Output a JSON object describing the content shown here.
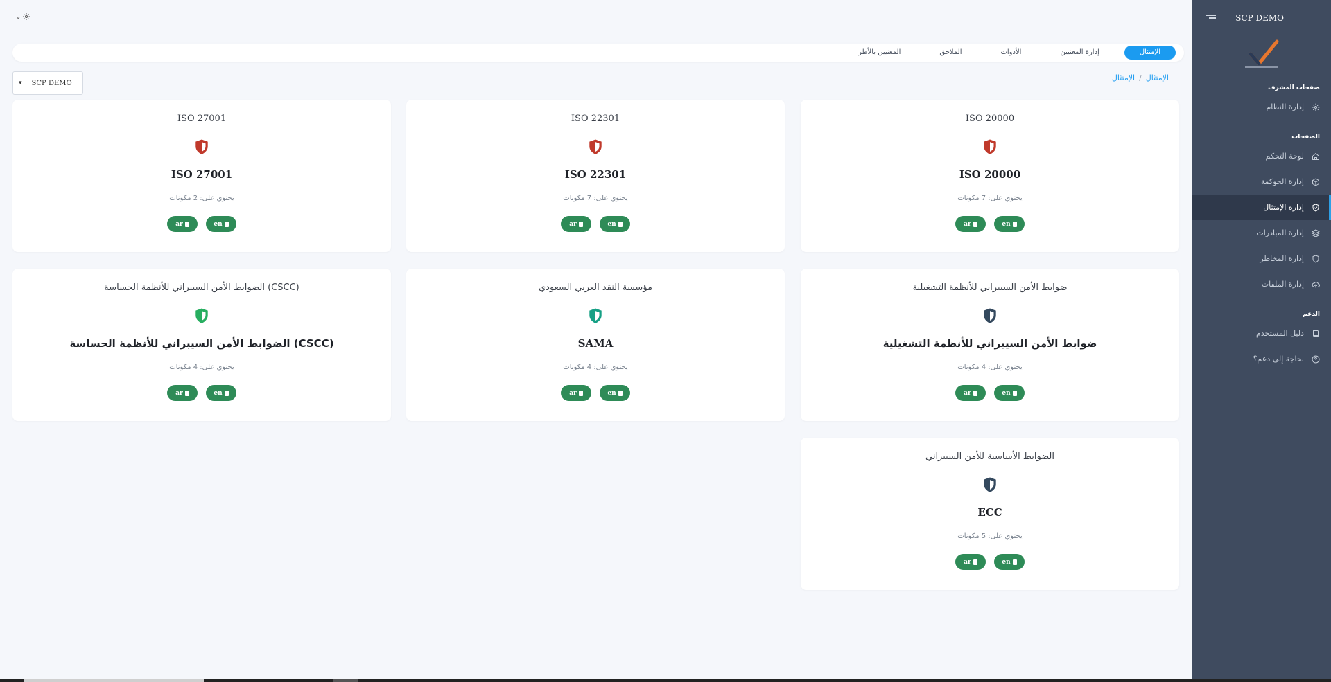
{
  "app": {
    "org_name": "SCP DEMO"
  },
  "sidebar": {
    "title": "SCP DEMO",
    "sections": [
      {
        "heading": "صفحات المشرف",
        "items": [
          {
            "label": "إدارة النظام",
            "icon": "gear-icon",
            "active": false
          }
        ]
      },
      {
        "heading": "الصفحات",
        "items": [
          {
            "label": "لوحة التحكم",
            "icon": "home-icon",
            "active": false
          },
          {
            "label": "إدارة الحوكمة",
            "icon": "box-icon",
            "active": false
          },
          {
            "label": "إدارة الإمتثال",
            "icon": "shield-check-icon",
            "active": true
          },
          {
            "label": "إدارة المبادرات",
            "icon": "layers-icon",
            "active": false
          },
          {
            "label": "إدارة المخاطر",
            "icon": "shield-icon",
            "active": false
          },
          {
            "label": "إدارة الملفات",
            "icon": "cloud-upload-icon",
            "active": false
          }
        ]
      },
      {
        "heading": "الدعم",
        "items": [
          {
            "label": "دليل المستخدم",
            "icon": "book-icon",
            "active": false
          },
          {
            "label": "بحاجة إلى دعم؟",
            "icon": "help-circle-icon",
            "active": false
          }
        ]
      }
    ]
  },
  "tabs": [
    {
      "label": "الإمتثال",
      "active": true
    },
    {
      "label": "إدارة المعنيين",
      "active": false
    },
    {
      "label": "الأدوات",
      "active": false
    },
    {
      "label": "الملاحق",
      "active": false
    },
    {
      "label": "المعنيين بالأطر",
      "active": false
    }
  ],
  "breadcrumb": {
    "root": "الإمتثال",
    "separator": "/",
    "current": "الإمتثال"
  },
  "org_select": {
    "value": "SCP DEMO"
  },
  "cards": [
    {
      "title": "ISO 20000",
      "name": "ISO 20000",
      "count": "يحتوي على: 7 مكونات",
      "shield_color": "#c0392b",
      "buttons": [
        "ar",
        "en"
      ]
    },
    {
      "title": "ISO 22301",
      "name": "ISO 22301",
      "count": "يحتوي على: 7 مكونات",
      "shield_color": "#c0392b",
      "buttons": [
        "ar",
        "en"
      ]
    },
    {
      "title": "ISO 27001",
      "name": "ISO 27001",
      "count": "يحتوي على: 2 مكونات",
      "shield_color": "#c0392b",
      "buttons": [
        "ar",
        "en"
      ]
    },
    {
      "title": "ضوابط الأمن السيبراني للأنظمة التشغيلية",
      "name": "ضوابط الأمن السيبراني للأنظمة التشغيلية",
      "count": "يحتوي على: 4 مكونات",
      "shield_color": "#34495e",
      "buttons": [
        "ar",
        "en"
      ]
    },
    {
      "title": "مؤسسة النقد العربي السعودي",
      "name": "SAMA",
      "count": "يحتوي على: 4 مكونات",
      "shield_color": "#16a085",
      "buttons": [
        "ar",
        "en"
      ]
    },
    {
      "title": "الضوابط الأمن السيبراني للأنظمة الحساسة (CSCC)",
      "name": "الضوابط الأمن السيبراني للأنظمة الحساسة (CSCC)",
      "count": "يحتوي على: 4 مكونات",
      "shield_color": "#27ae60",
      "buttons": [
        "ar",
        "en"
      ]
    },
    {
      "title": "الضوابط الأساسية للأمن السيبراني",
      "name": "ECC",
      "count": "يحتوي على: 5 مكونات",
      "shield_color": "#34495e",
      "buttons": [
        "ar",
        "en"
      ]
    }
  ],
  "colors": {
    "accent": "#1b9bf0",
    "sidebar_bg": "#3f4b5f",
    "sidebar_active_bg": "#2f394b",
    "button_green": "#2e8b57"
  }
}
